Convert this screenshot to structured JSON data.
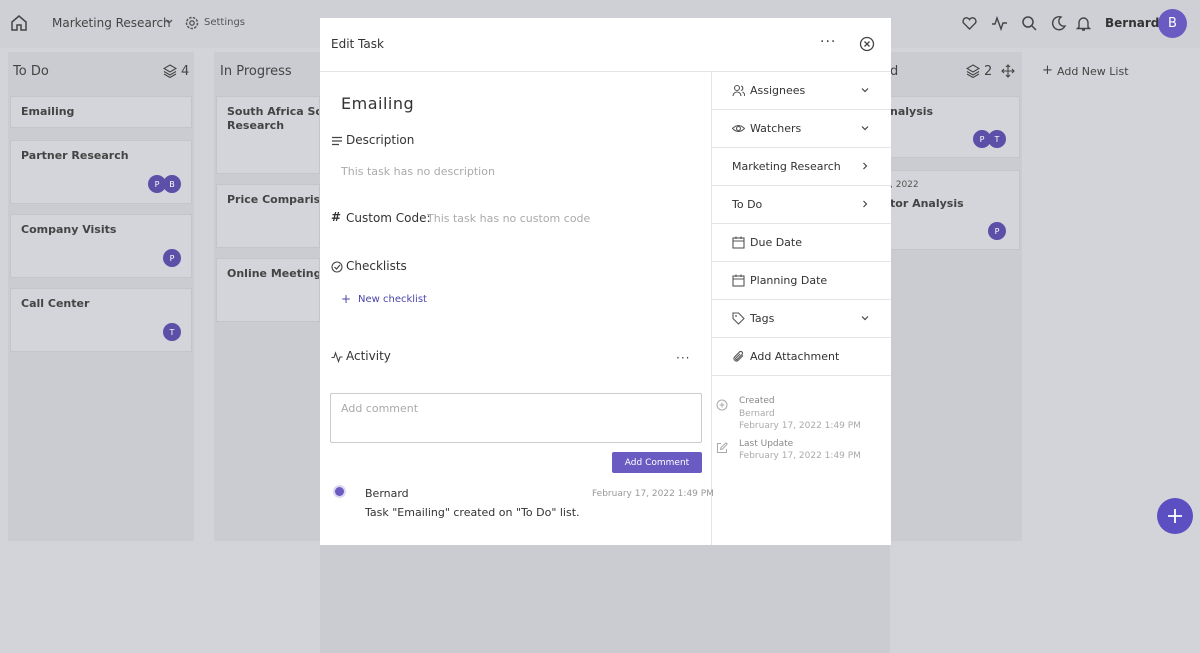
{
  "topbar": {
    "project": "Marketing Research",
    "settings": "Settings",
    "user": "Bernard",
    "user_initial": "B"
  },
  "board": {
    "columns": [
      {
        "title": "To Do",
        "count": "4"
      },
      {
        "title": "In Progress"
      },
      {
        "title": "d",
        "count": "2"
      }
    ],
    "add_list": "Add New List",
    "todo_cards": [
      {
        "title": "Emailing"
      },
      {
        "title": "Partner Research",
        "avatars": [
          "P",
          "B"
        ]
      },
      {
        "title": "Company Visits",
        "avatars": [
          "P"
        ]
      },
      {
        "title": "Call Center",
        "avatars": [
          "T"
        ]
      }
    ],
    "progress_cards": [
      {
        "title": "South Africa Softw Research"
      },
      {
        "title": "Price Comparison"
      },
      {
        "title": "Online Meetings"
      }
    ],
    "right_cards": [
      {
        "title": "nalysis",
        "avatars": [
          "P",
          "T"
        ]
      },
      {
        "date": ", 2022",
        "title": "tor Analysis",
        "avatars": [
          "P"
        ]
      }
    ]
  },
  "modal": {
    "title": "Edit Task",
    "task_name": "Emailing",
    "description_label": "Description",
    "description_placeholder": "This task has no description",
    "custom_code_label": "Custom Code:",
    "custom_code_placeholder": "This task has no custom code",
    "checklists_label": "Checklists",
    "new_checklist": "New checklist",
    "activity_label": "Activity",
    "comment_placeholder": "Add comment",
    "add_comment": "Add Comment",
    "activity": [
      {
        "user": "Bernard",
        "date": "February 17, 2022 1:49 PM",
        "text": "Task \"Emailing\" created on \"To Do\" list."
      }
    ],
    "sidebar": {
      "assignees": "Assignees",
      "watchers": "Watchers",
      "project": "Marketing Research",
      "list": "To Do",
      "due_date": "Due Date",
      "planning_date": "Planning Date",
      "tags": "Tags",
      "add_attachment": "Add Attachment",
      "created_label": "Created",
      "created_by": "Bernard",
      "created_date": "February 17, 2022 1:49 PM",
      "updated_label": "Last Update",
      "updated_date": "February 17, 2022 1:49 PM"
    }
  },
  "colors": {
    "accent": "#6a5bc2",
    "fab": "#5b4fc2"
  }
}
